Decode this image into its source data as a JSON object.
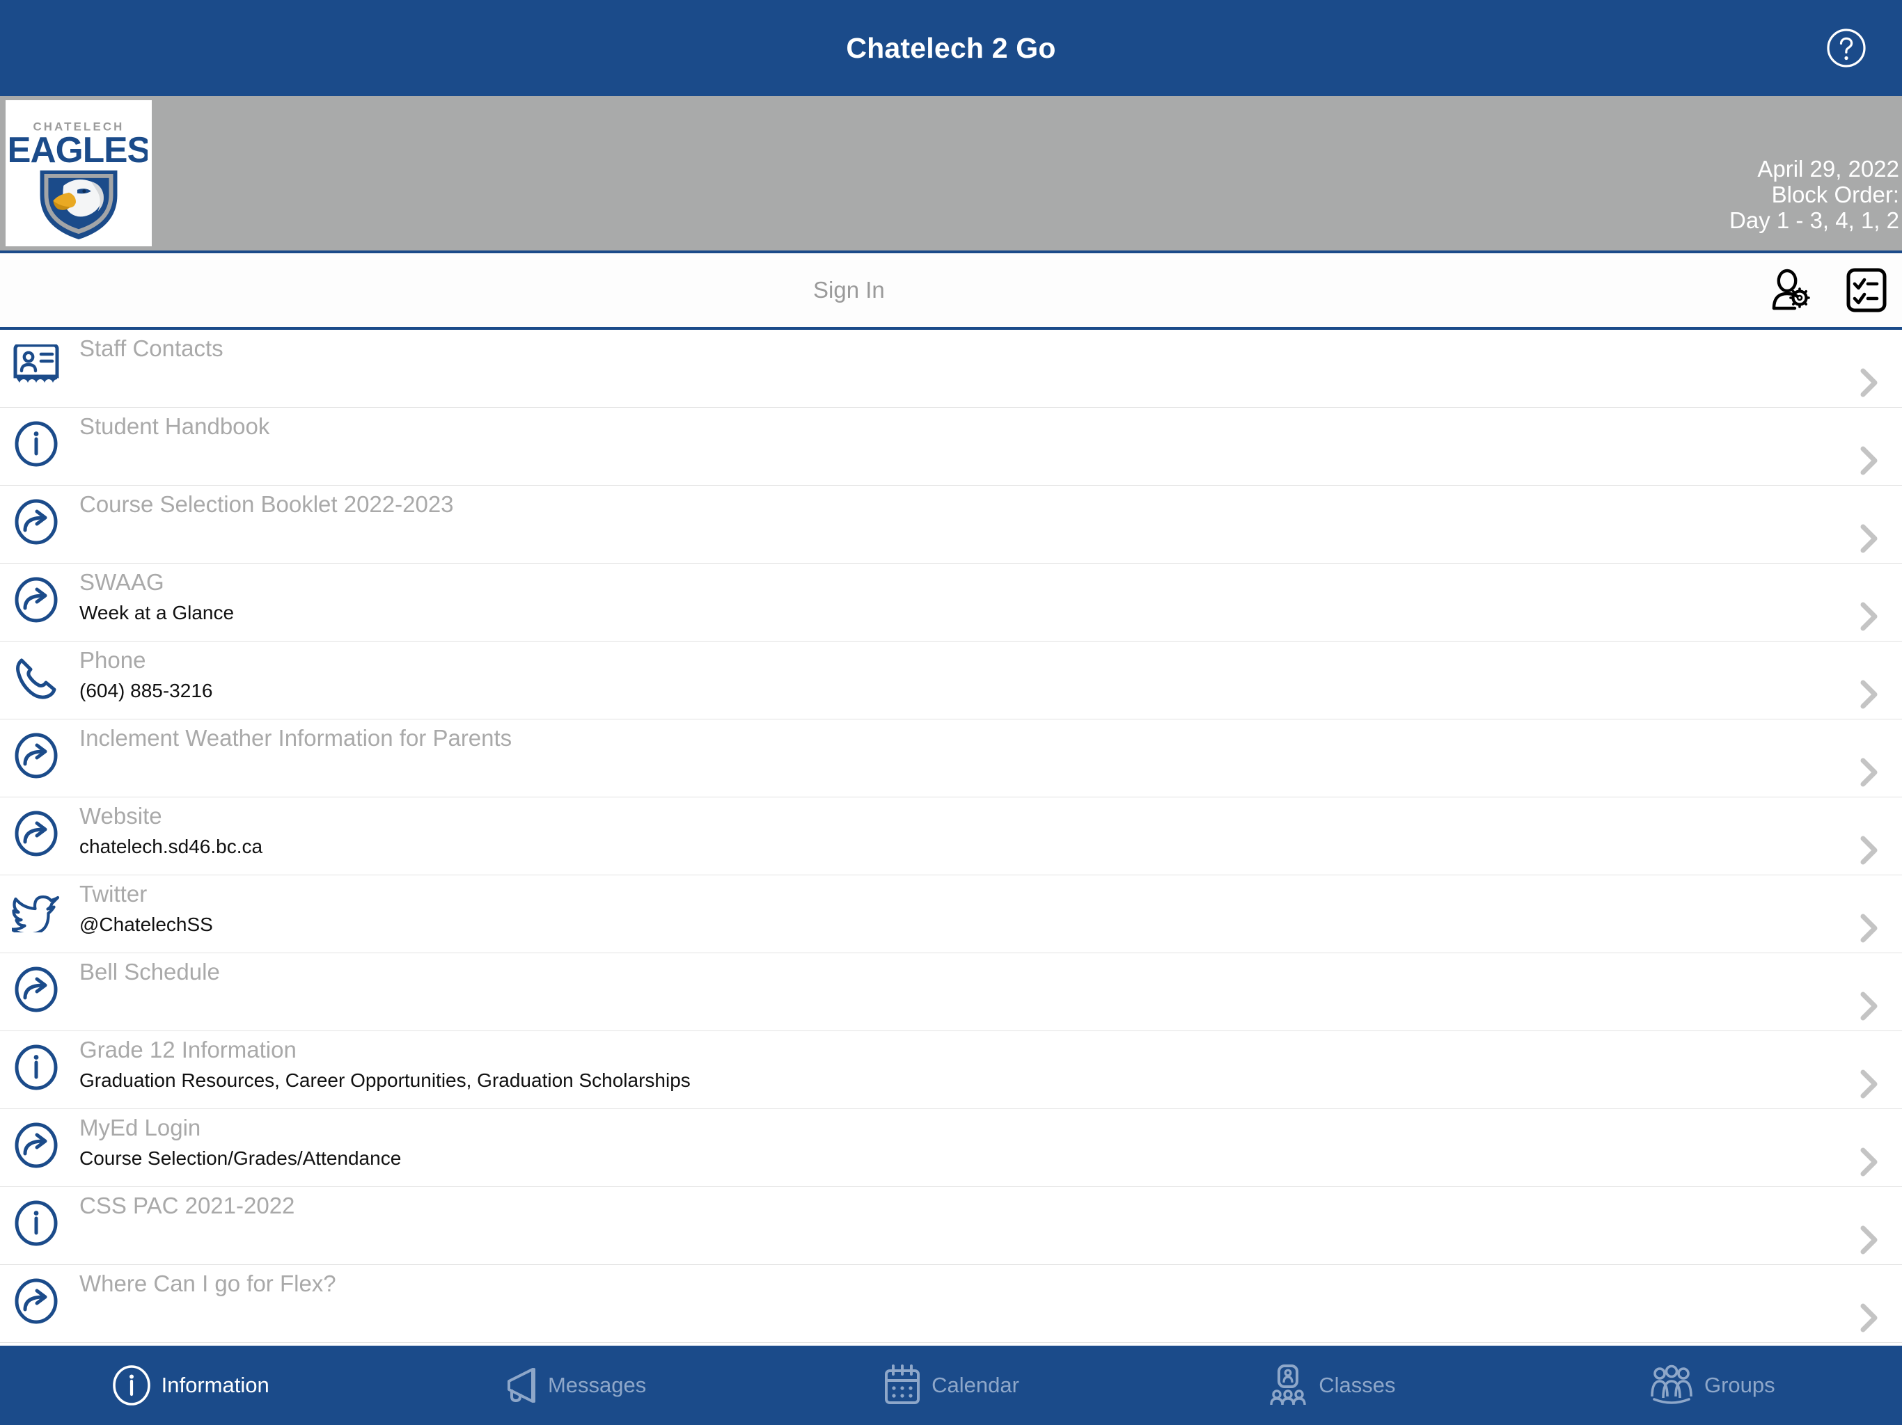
{
  "header": {
    "title": "Chatelech 2 Go",
    "help_icon": "help-circle-icon",
    "bg_color": "#1b4b8a"
  },
  "school_band": {
    "logo_alt": "CHATELECH EAGLES",
    "logo_word_top": "CHATELECH",
    "logo_word_main": "EAGLES",
    "date": "April 29, 2022",
    "block_order_label": "Block Order:",
    "block_order_value": "Day 1 - 3, 4, 1, 2",
    "bg_color": "#a9aaaa"
  },
  "signin": {
    "label": "Sign In",
    "account_settings_icon": "user-gear-icon",
    "checklist_icon": "checklist-icon"
  },
  "list": {
    "chevron_icon": "chevron-right-icon",
    "items": [
      {
        "icon": "contact-card-icon",
        "title": "Staff Contacts",
        "sub": ""
      },
      {
        "icon": "info-circle-icon",
        "title": "Student Handbook",
        "sub": ""
      },
      {
        "icon": "external-link-icon",
        "title": "Course Selection Booklet 2022-2023",
        "sub": ""
      },
      {
        "icon": "external-link-icon",
        "title": "SWAAG",
        "sub": "Week at a Glance"
      },
      {
        "icon": "phone-icon",
        "title": "Phone",
        "sub": "(604) 885-3216"
      },
      {
        "icon": "external-link-icon",
        "title": "Inclement Weather Information for Parents",
        "sub": ""
      },
      {
        "icon": "external-link-icon",
        "title": "Website",
        "sub": "chatelech.sd46.bc.ca"
      },
      {
        "icon": "twitter-icon",
        "title": "Twitter",
        "sub": "@ChatelechSS"
      },
      {
        "icon": "external-link-icon",
        "title": "Bell Schedule",
        "sub": ""
      },
      {
        "icon": "info-circle-icon",
        "title": "Grade 12 Information",
        "sub": "Graduation Resources, Career Opportunities, Graduation Scholarships"
      },
      {
        "icon": "external-link-icon",
        "title": "MyEd Login",
        "sub": "Course Selection/Grades/Attendance"
      },
      {
        "icon": "info-circle-icon",
        "title": "CSS PAC 2021-2022",
        "sub": ""
      },
      {
        "icon": "external-link-icon",
        "title": "Where Can I go for Flex?",
        "sub": ""
      }
    ]
  },
  "tabbar": {
    "active_index": 0,
    "active_color": "#ffffff",
    "inactive_color": "#8ea7c9",
    "tabs": [
      {
        "label": "Information",
        "icon": "info-circle-icon"
      },
      {
        "label": "Messages",
        "icon": "megaphone-icon"
      },
      {
        "label": "Calendar",
        "icon": "calendar-icon"
      },
      {
        "label": "Classes",
        "icon": "classes-icon"
      },
      {
        "label": "Groups",
        "icon": "groups-icon"
      }
    ]
  }
}
